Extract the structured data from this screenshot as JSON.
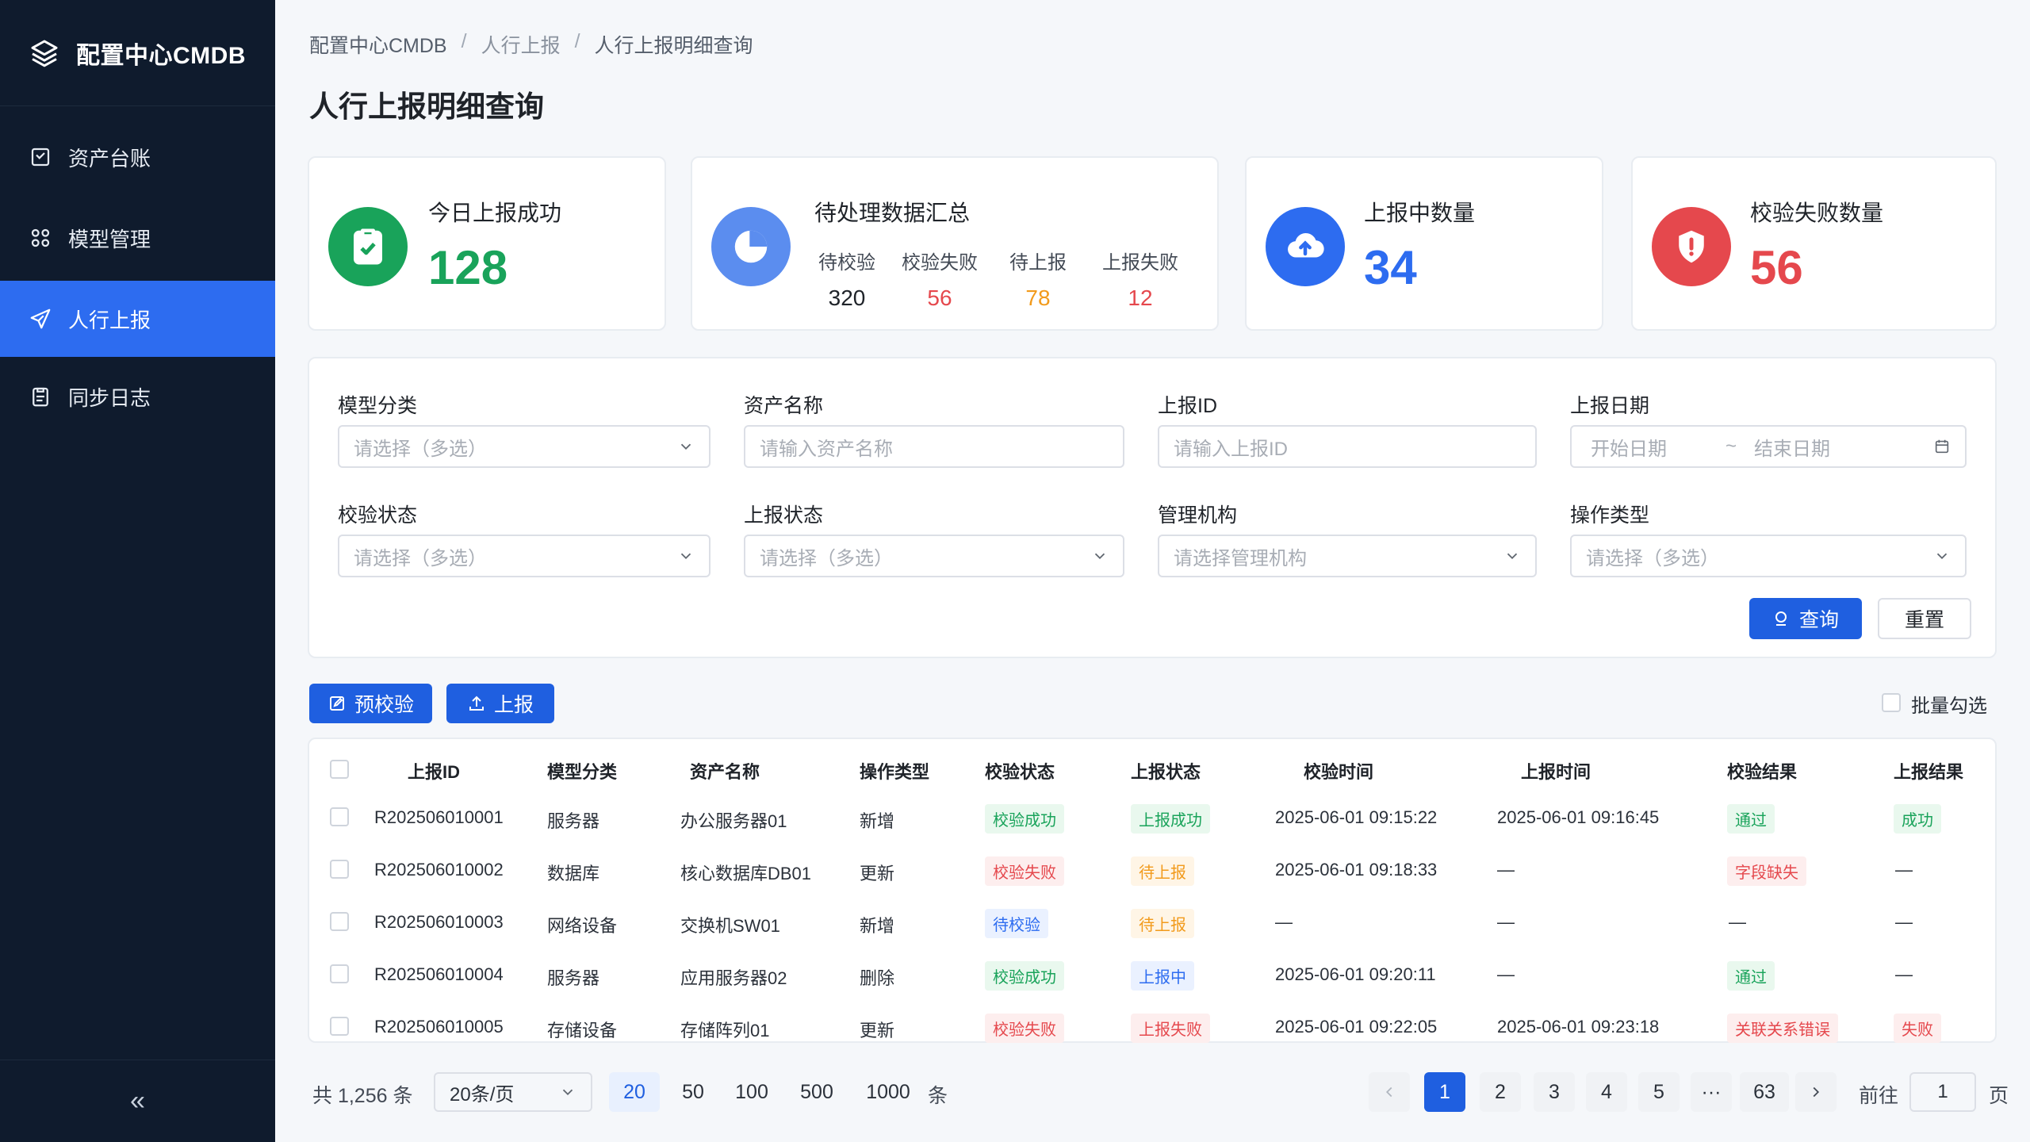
{
  "sidebar": {
    "brand": "配置中心CMDB",
    "items": [
      {
        "label": "资产台账"
      },
      {
        "label": "模型管理"
      },
      {
        "label": "人行上报"
      },
      {
        "label": "同步日志"
      }
    ],
    "collapse": "«"
  },
  "breadcrumb": [
    "配置中心CMDB",
    "人行上报",
    "人行上报明细查询"
  ],
  "page_title": "人行上报明细查询",
  "cards": {
    "today_success": {
      "title": "今日上报成功",
      "value": "128",
      "color": "#19a35a"
    },
    "pending": {
      "title": "待处理数据汇总",
      "stats": [
        {
          "label": "待校验",
          "value": "320"
        },
        {
          "label": "校验失败",
          "value": "56"
        },
        {
          "label": "待上报",
          "value": "78"
        },
        {
          "label": "上报失败",
          "value": "12"
        }
      ]
    },
    "reporting": {
      "title": "上报中数量",
      "value": "34",
      "color": "#2d6cf0"
    },
    "verify_fail": {
      "title": "校验失败数量",
      "value": "56",
      "color": "#e5484d"
    }
  },
  "filters": {
    "model_category": {
      "label": "模型分类",
      "placeholder": "请选择（多选）"
    },
    "asset_name": {
      "label": "资产名称",
      "placeholder": "请输入资产名称"
    },
    "report_id": {
      "label": "上报ID",
      "placeholder": "请输入上报ID"
    },
    "report_date": {
      "label": "上报日期",
      "start": "开始日期",
      "sep": "~",
      "end": "结束日期"
    },
    "verify_status": {
      "label": "校验状态",
      "placeholder": "请选择（多选）"
    },
    "report_status": {
      "label": "上报状态",
      "placeholder": "请选择（多选）"
    },
    "org": {
      "label": "管理机构",
      "placeholder": "请选择管理机构"
    },
    "op_type": {
      "label": "操作类型",
      "placeholder": "请选择（多选）"
    },
    "search_btn": "查询",
    "reset_btn": "重置"
  },
  "actions": {
    "precheck": "预校验",
    "report": "上报",
    "batch_select": "批量勾选"
  },
  "table": {
    "headers": [
      "上报ID",
      "模型分类",
      "资产名称",
      "操作类型",
      "校验状态",
      "上报状态",
      "校验时间",
      "上报时间",
      "校验结果",
      "上报结果"
    ],
    "rows": [
      {
        "id": "R202506010001",
        "category": "服务器",
        "name": "办公服务器01",
        "op": "新增",
        "verify": "校验成功",
        "report": "上报成功",
        "vtime": "2025-06-01 09:15:22",
        "rtime": "2025-06-01 09:16:45",
        "vresult": "通过",
        "rresult": "成功"
      },
      {
        "id": "R202506010002",
        "category": "数据库",
        "name": "核心数据库DB01",
        "op": "更新",
        "verify": "校验失败",
        "report": "待上报",
        "vtime": "2025-06-01 09:18:33",
        "rtime": "—",
        "vresult": "字段缺失",
        "rresult": "—"
      },
      {
        "id": "R202506010003",
        "category": "网络设备",
        "name": "交换机SW01",
        "op": "新增",
        "verify": "待校验",
        "report": "待上报",
        "vtime": "—",
        "rtime": "—",
        "vresult": "—",
        "rresult": "—"
      },
      {
        "id": "R202506010004",
        "category": "服务器",
        "name": "应用服务器02",
        "op": "删除",
        "verify": "校验成功",
        "report": "上报中",
        "vtime": "2025-06-01 09:20:11",
        "rtime": "—",
        "vresult": "通过",
        "rresult": "—"
      },
      {
        "id": "R202506010005",
        "category": "存储设备",
        "name": "存储阵列01",
        "op": "更新",
        "verify": "校验失败",
        "report": "上报失败",
        "vtime": "2025-06-01 09:22:05",
        "rtime": "2025-06-01 09:23:18",
        "vresult": "关联关系错误",
        "rresult": "失败"
      }
    ]
  },
  "pagination": {
    "total": "共 1,256 条",
    "page_size": "20条/页",
    "sizes": [
      "20",
      "50",
      "100",
      "500",
      "1000"
    ],
    "sizes_unit": "条",
    "pages": [
      "1",
      "2",
      "3",
      "4",
      "5",
      "···",
      "63"
    ],
    "goto_label": "前往",
    "goto_value": "1",
    "goto_unit": "页"
  }
}
